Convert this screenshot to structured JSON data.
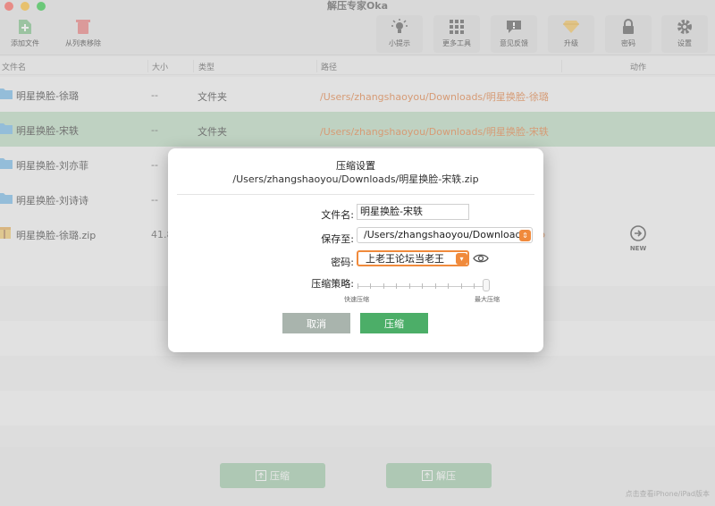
{
  "window": {
    "title": "解压专家Oka"
  },
  "toolbar": {
    "add_file": "添加文件",
    "remove": "从列表移除",
    "tips": "小提示",
    "more_tools": "更多工具",
    "feedback": "意见反馈",
    "upgrade": "升级",
    "password": "密码",
    "settings": "设置"
  },
  "columns": {
    "name": "文件名",
    "size": "大小",
    "type": "类型",
    "path": "路径",
    "action": "动作"
  },
  "rows": [
    {
      "name": "明星换脸-徐璐",
      "size": "--",
      "type": "文件夹",
      "path": "/Users/zhangshaoyou/Downloads/明星换脸-徐璐"
    },
    {
      "name": "明星换脸-宋轶",
      "size": "--",
      "type": "文件夹",
      "path": "/Users/zhangshaoyou/Downloads/明星换脸-宋轶"
    },
    {
      "name": "明星换脸-刘亦菲",
      "size": "--",
      "type": "",
      "path": ""
    },
    {
      "name": "明星换脸-刘诗诗",
      "size": "--",
      "type": "",
      "path": ""
    },
    {
      "name": "明星换脸-徐璐.zip",
      "size": "41.8",
      "type": "",
      "path": "ip"
    }
  ],
  "action_badge": "NEW",
  "bottom": {
    "compress": "压缩",
    "extract": "解压",
    "ipad_link": "点击查看iPhone/iPad版本"
  },
  "dialog": {
    "title": "压缩设置",
    "subtitle": "/Users/zhangshaoyou/Downloads/明星换脸-宋轶.zip",
    "filename_label": "文件名:",
    "filename_value": "明星换脸-宋轶",
    "saveto_label": "保存至:",
    "saveto_value": "/Users/zhangshaoyou/Downloads",
    "password_label": "密码:",
    "password_value": "上老王论坛当老王",
    "strategy_label": "压缩策略:",
    "strategy_level": 1.0,
    "fast_label": "快速压缩",
    "max_label": "最大压缩",
    "cancel": "取消",
    "compress": "压缩"
  },
  "colors": {
    "accent_green": "#4cae68",
    "cancel_gray": "#a9b4ad",
    "path_orange": "#e07a3a",
    "selected_row": "#b9d9bd"
  }
}
